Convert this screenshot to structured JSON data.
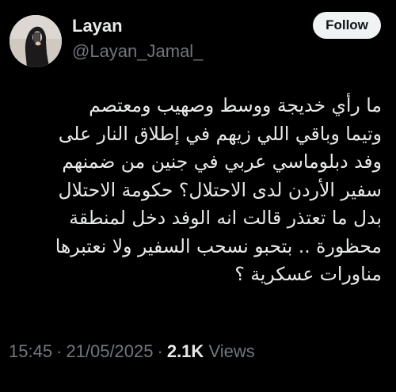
{
  "tweet": {
    "author": {
      "display_name": "Layan",
      "handle": "@Layan_Jamal_",
      "avatar_icon": "profile-photo"
    },
    "follow_label": "Follow",
    "text_lines": [
      "ما رأي خديجة ووسط وصهيب ومعتصم",
      "وتيما وباقي اللي زيهم في إطلاق النار على",
      "وفد دبلوماسي عربي في جنين من ضمنهم",
      "سفير الأردن لدى الاحتلال؟ حكومة الاحتلال",
      "بدل ما تعتذر قالت انه الوفد دخل لمنطقة",
      "محظورة .. بتحبو نسحب السفير ولا نعتبرها",
      "مناورات عسكرية ؟"
    ],
    "time": "15:45",
    "date": "21/05/2025",
    "views_count": "2.1K",
    "views_label": "Views"
  },
  "colors": {
    "background": "#000000",
    "primary_text": "#e7e9ea",
    "secondary_text": "#71767b",
    "follow_button_bg": "#eff3f4",
    "follow_button_text": "#0f1419"
  }
}
